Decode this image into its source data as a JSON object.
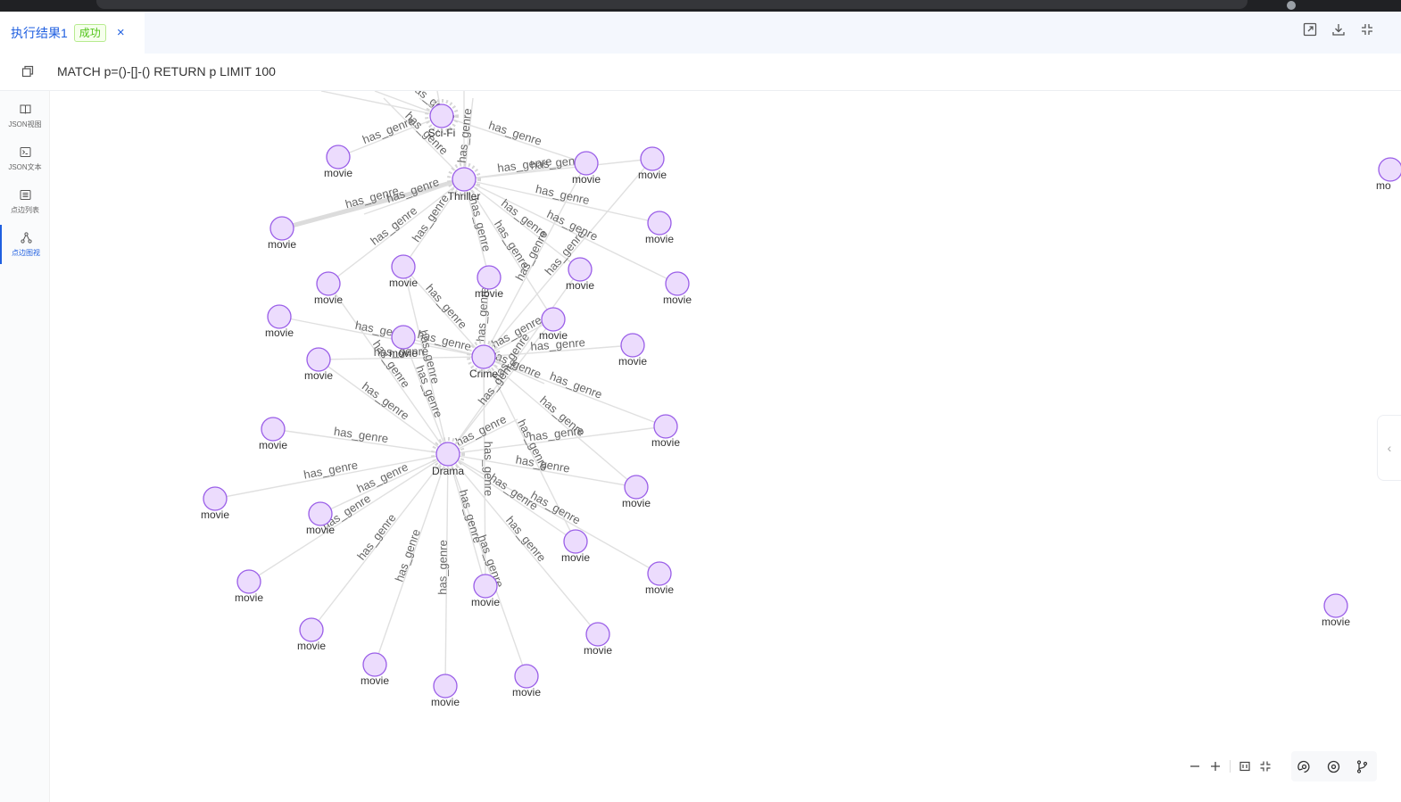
{
  "tab": {
    "title": "执行结果1",
    "status": "成功",
    "close_glyph": "×"
  },
  "top_actions": [
    "open-new-window-icon",
    "download-icon",
    "collapse-icon"
  ],
  "query": {
    "text": "MATCH p=()-[]-() RETURN p LIMIT 100"
  },
  "sidebar": {
    "items": [
      {
        "label": "JSON视图",
        "icon": "book-icon"
      },
      {
        "label": "JSON文本",
        "icon": "terminal-icon"
      },
      {
        "label": "点边列表",
        "icon": "list-icon"
      },
      {
        "label": "点边图视",
        "icon": "graph-icon",
        "active": true
      }
    ]
  },
  "graph": {
    "edge_label": "has_genre",
    "genres": [
      {
        "id": "scifi",
        "label": "Sci-Fi"
      },
      {
        "id": "thriller",
        "label": "Thriller"
      },
      {
        "id": "crime",
        "label": "Crime"
      },
      {
        "id": "drama",
        "label": "Drama"
      }
    ],
    "movie_label": "movie",
    "movie_count": 37,
    "partial_label": "mo"
  },
  "toolbar": {
    "zoom_out": "minus-icon",
    "zoom_in": "plus-icon",
    "fit": "fit-view-icon",
    "fullscreen": "shrink-icon",
    "layouts": [
      "force-layout-icon",
      "radial-layout-icon",
      "tree-layout-icon"
    ]
  },
  "colors": {
    "accent": "#1f5fe0",
    "success": "#52c41a",
    "node_fill": "#ecdcfd",
    "node_stroke": "#9a5ee8",
    "edge": "#e0e0e0"
  }
}
